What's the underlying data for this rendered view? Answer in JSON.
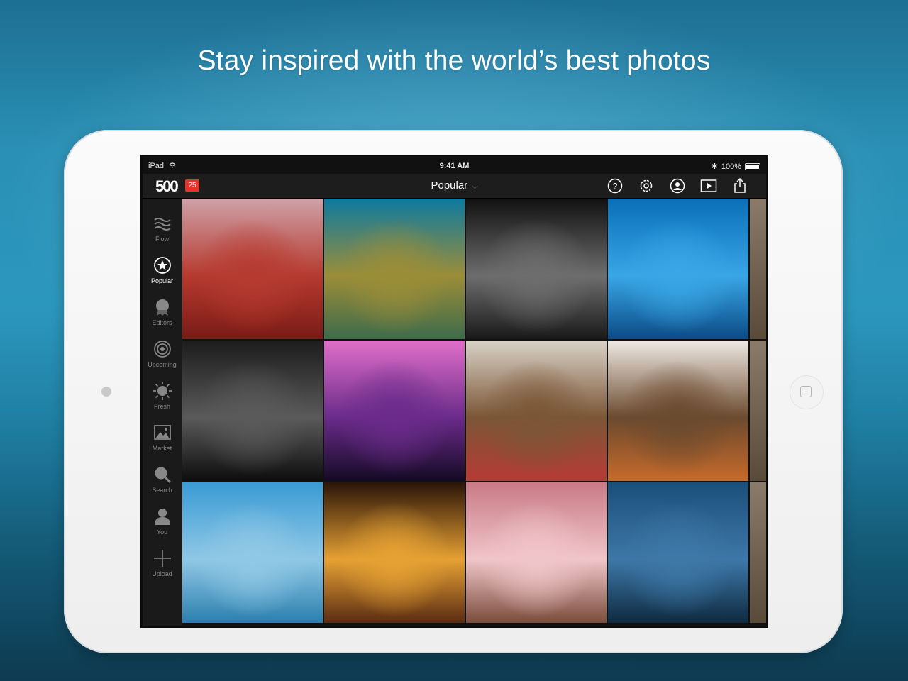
{
  "headline": "Stay inspired with the world’s best photos",
  "status_bar": {
    "device": "iPad",
    "time": "9:41 AM",
    "battery": "100%"
  },
  "nav": {
    "logo": "500",
    "badge": "25",
    "title": "Popular"
  },
  "nav_icons": [
    "help-icon",
    "settings-icon",
    "profile-icon",
    "slideshow-icon",
    "share-icon"
  ],
  "sidebar": {
    "items": [
      {
        "label": "Flow",
        "icon": "flow-icon"
      },
      {
        "label": "Popular",
        "icon": "star-icon",
        "active": true
      },
      {
        "label": "Editors",
        "icon": "ribbon-icon"
      },
      {
        "label": "Upcoming",
        "icon": "target-icon"
      },
      {
        "label": "Fresh",
        "icon": "sun-icon"
      },
      {
        "label": "Market",
        "icon": "picture-icon"
      },
      {
        "label": "Search",
        "icon": "search-icon"
      },
      {
        "label": "You",
        "icon": "user-icon"
      },
      {
        "label": "Upload",
        "icon": "plus-icon"
      }
    ]
  },
  "photos": [
    {
      "subject": "red desert butte at sunset",
      "colors": [
        "#cfa1a8",
        "#b63a2f",
        "#7a1b16"
      ]
    },
    {
      "subject": "sea turtle underwater",
      "colors": [
        "#0d7aa0",
        "#9b8d38",
        "#3f6b4b"
      ]
    },
    {
      "subject": "black and white portrait of a boy",
      "colors": [
        "#111111",
        "#6d6d6d",
        "#1a1a1a"
      ]
    },
    {
      "subject": "surfer in a blue wave",
      "colors": [
        "#0a6fb8",
        "#39a6e6",
        "#0b4b86"
      ]
    },
    {
      "subject": "couple under umbrella in rain",
      "colors": [
        "#1c1c1c",
        "#5a5a5a",
        "#0d0d0d"
      ]
    },
    {
      "subject": "purple lake at dusk",
      "colors": [
        "#e06fc9",
        "#6a2b8a",
        "#140a24"
      ]
    },
    {
      "subject": "child carried in colorful blanket",
      "colors": [
        "#d9d2c7",
        "#7b5636",
        "#b73b36"
      ]
    },
    {
      "subject": "eagle and fox in snow",
      "colors": [
        "#efe9e4",
        "#6b4a2e",
        "#c86a2a"
      ]
    },
    {
      "subject": "snowy mountain over blue lake",
      "colors": [
        "#3a9bd4",
        "#8fc8e6",
        "#2b7fad"
      ]
    },
    {
      "subject": "silhouette in arched doorway",
      "colors": [
        "#2a1408",
        "#e6a133",
        "#5a2c12"
      ]
    },
    {
      "subject": "pink water droplets macro",
      "colors": [
        "#c97a86",
        "#f0c5c9",
        "#7a4d3b"
      ]
    },
    {
      "subject": "coastal bridge at twilight",
      "colors": [
        "#1b4f7a",
        "#3d78a8",
        "#0f2a40"
      ]
    }
  ]
}
